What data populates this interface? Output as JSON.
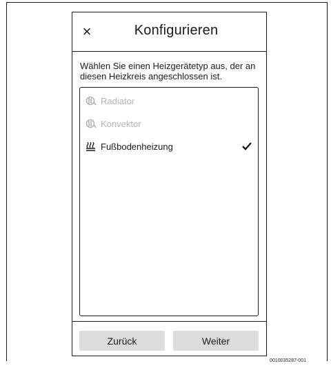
{
  "header": {
    "close_symbol": "×",
    "title": "Konfigurieren"
  },
  "instruction": "Wählen Sie einen Heizgerätetyp aus, der an diesen Heizkreis angeschlossen ist.",
  "options": [
    {
      "label": "Radiator",
      "icon": "radiator-icon",
      "disabled": true,
      "selected": false
    },
    {
      "label": "Konvektor",
      "icon": "convector-icon",
      "disabled": true,
      "selected": false
    },
    {
      "label": "Fußbodenheizung",
      "icon": "floor-heating-icon",
      "disabled": false,
      "selected": true
    }
  ],
  "footer": {
    "back_label": "Zurück",
    "next_label": "Weiter"
  },
  "caption": "0010035287-001",
  "colors": {
    "disabled_text": "#b3b3b3",
    "button_bg": "#dcdcdc",
    "text": "#1a1a1a"
  }
}
